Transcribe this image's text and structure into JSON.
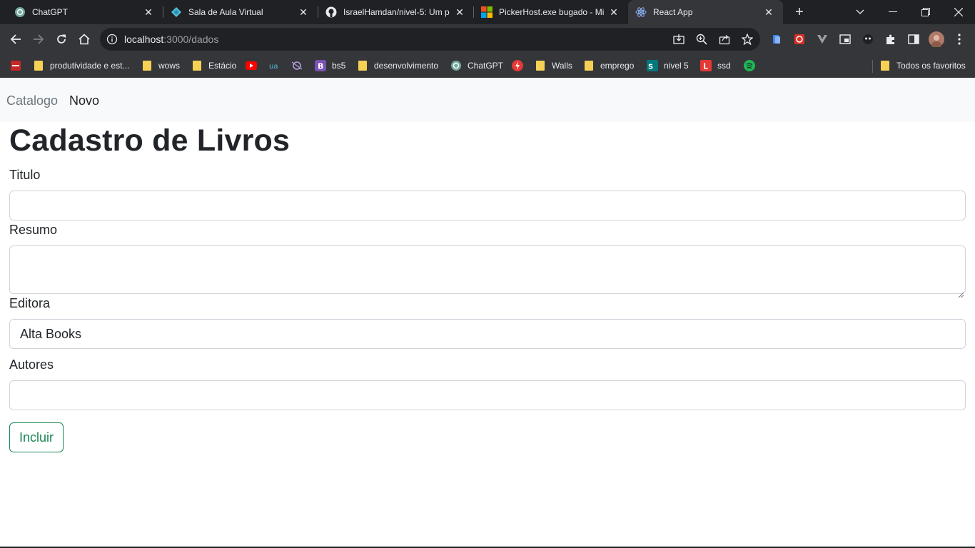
{
  "browser": {
    "tabs": [
      {
        "title": "ChatGPT",
        "icon": "chatgpt-icon"
      },
      {
        "title": "Sala de Aula Virtual",
        "icon": "diamond-icon"
      },
      {
        "title": "IsraelHamdan/nivel-5: Um p",
        "icon": "github-icon"
      },
      {
        "title": "PickerHost.exe bugado - Mi",
        "icon": "microsoft-icon"
      },
      {
        "title": "React App",
        "icon": "react-icon"
      }
    ],
    "active_tab_index": 4,
    "url_host": "localhost",
    "url_path": ":3000/dados",
    "bookmarks": [
      {
        "label": "",
        "icon": "red-app-icon"
      },
      {
        "label": "produtividade e est...",
        "icon": "folder-icon"
      },
      {
        "label": "wows",
        "icon": "folder-icon"
      },
      {
        "label": "Estácio",
        "icon": "folder-icon"
      },
      {
        "label": "",
        "icon": "youtube-icon"
      },
      {
        "label": "",
        "icon": "ua-icon"
      },
      {
        "label": "",
        "icon": "ai-icon"
      },
      {
        "label": "bs5",
        "icon": "bootstrap-icon"
      },
      {
        "label": "desenvolvimento",
        "icon": "folder-icon"
      },
      {
        "label": "ChatGPT",
        "icon": "chatgpt-icon"
      },
      {
        "label": "",
        "icon": "bolt-icon"
      },
      {
        "label": "Walls",
        "icon": "folder-icon"
      },
      {
        "label": "emprego",
        "icon": "folder-icon"
      },
      {
        "label": "nivel 5",
        "icon": "sharepoint-icon"
      },
      {
        "label": "ssd",
        "icon": "l-icon"
      },
      {
        "label": "",
        "icon": "spotify-icon"
      }
    ],
    "all_bookmarks_label": "Todos os favoritos"
  },
  "nav": {
    "links": [
      {
        "label": "Catalogo"
      },
      {
        "label": "Novo"
      }
    ]
  },
  "page": {
    "title": "Cadastro de Livros",
    "form": {
      "titulo_label": "Titulo",
      "titulo_value": "",
      "resumo_label": "Resumo",
      "resumo_value": "",
      "editora_label": "Editora",
      "editora_value": "Alta Books",
      "autores_label": "Autores",
      "autores_value": "",
      "submit_label": "Incluir"
    }
  },
  "colors": {
    "primary_text": "#212529",
    "muted_text": "#6c757d",
    "success": "#198754",
    "navbar_bg": "#f8f9fa"
  }
}
